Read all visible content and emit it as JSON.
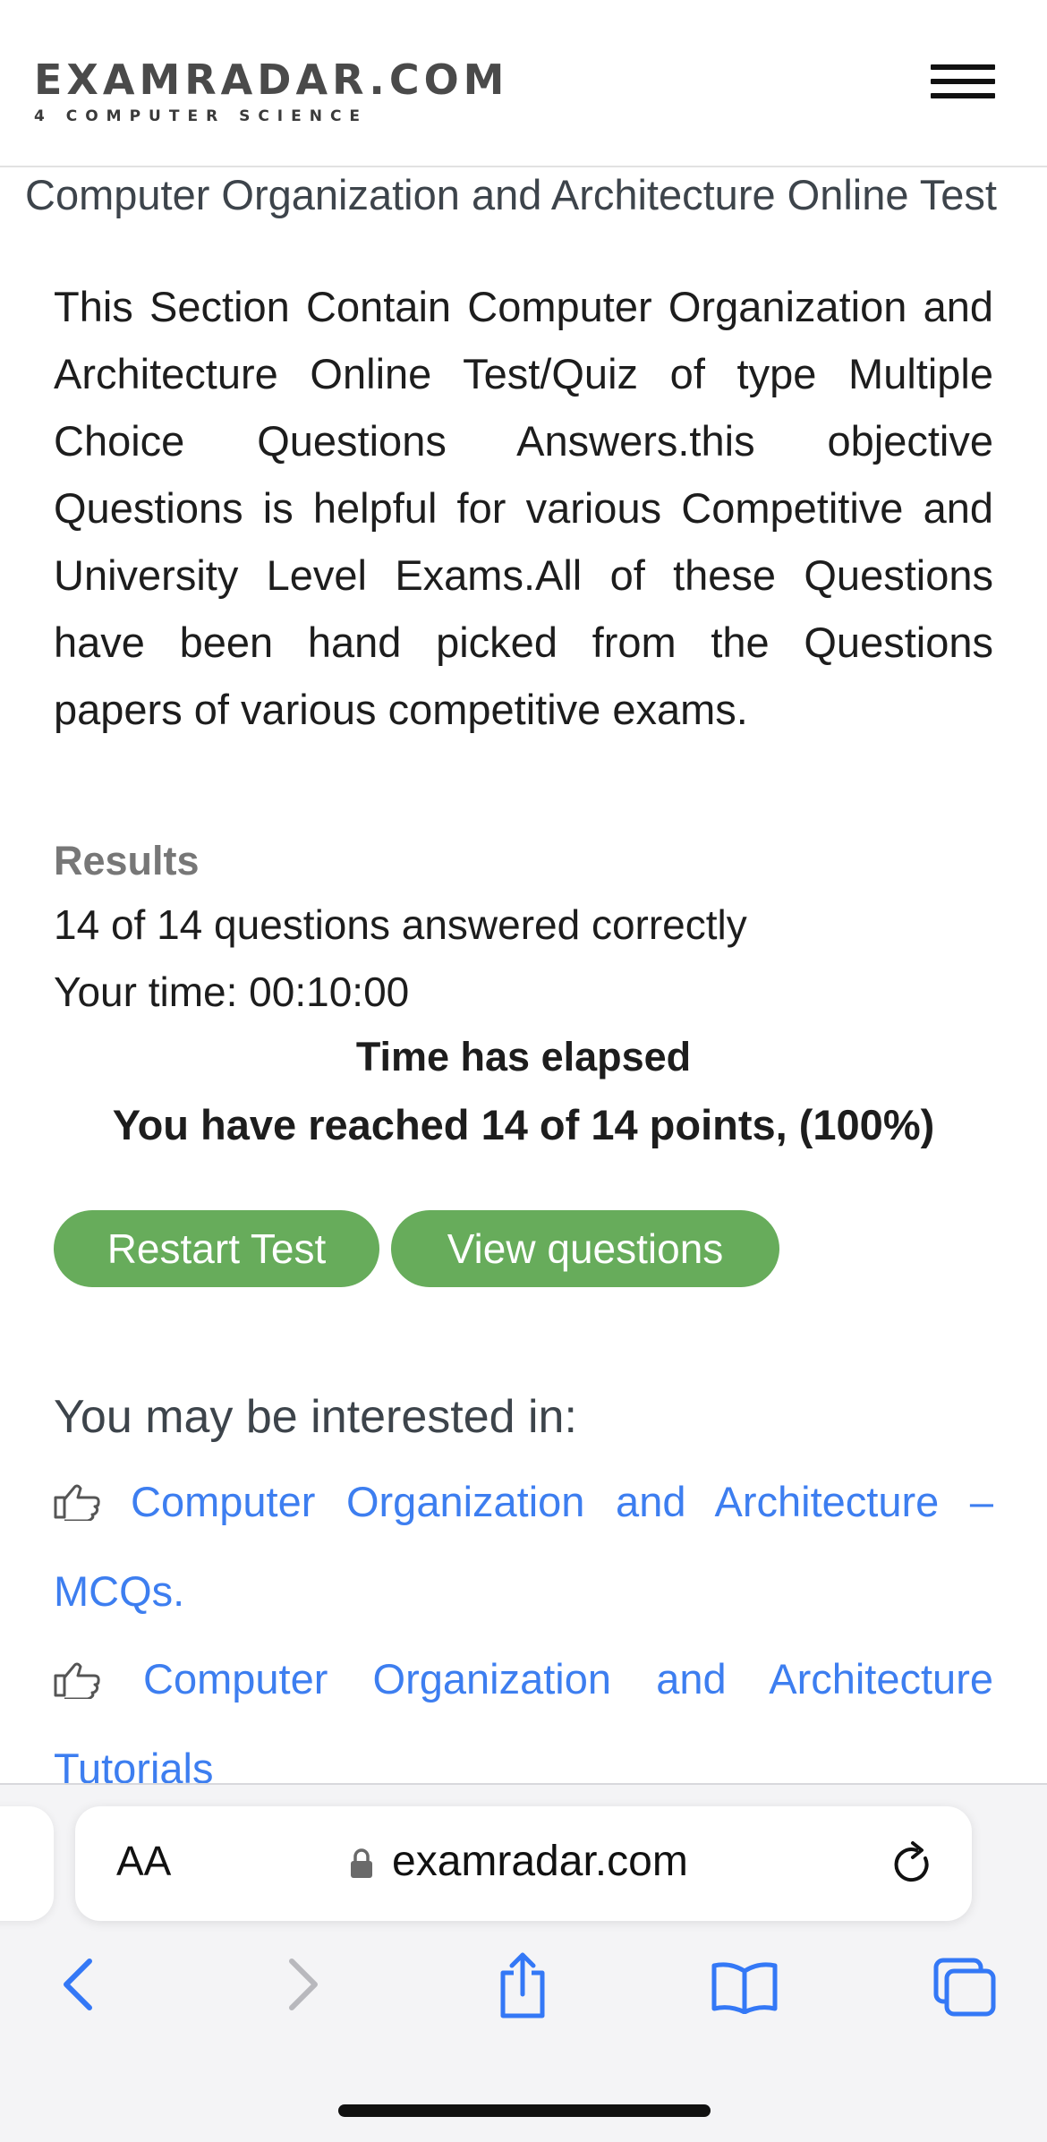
{
  "header": {
    "logo_main": "EXAMRADAR.COM",
    "logo_sub": "4 COMPUTER SCIENCE"
  },
  "page_title": "Computer Organization and Architecture Online Test",
  "intro": "This Section Contain Computer Organization and Architecture Online Test/Quiz of type Multiple Choice Questions Answers.this objective Questions is helpful for various Competitive and University Level Exams.All of these Questions have been hand picked from the Questions papers of various competitive exams.",
  "results": {
    "heading": "Results",
    "answered": "14 of 14 questions answered correctly",
    "time": "Your time: 00:10:00",
    "elapsed": "Time has elapsed",
    "points": "You have reached 14 of 14 points, (100%)"
  },
  "buttons": {
    "restart": "Restart Test",
    "view": "View questions"
  },
  "interested": {
    "heading": "You may be interested in:",
    "links": [
      {
        "line1": "Computer Organization and Architecture –",
        "line2": "MCQs."
      },
      {
        "line1": "Computer Organization and Architecture",
        "line2": "Tutorials"
      }
    ]
  },
  "browser": {
    "aa_label": "AA",
    "url": "examradar.com"
  },
  "colors": {
    "button_green": "#67ac5b",
    "link_blue": "#3d7ef0",
    "toolbar_blue": "#3478f6"
  }
}
